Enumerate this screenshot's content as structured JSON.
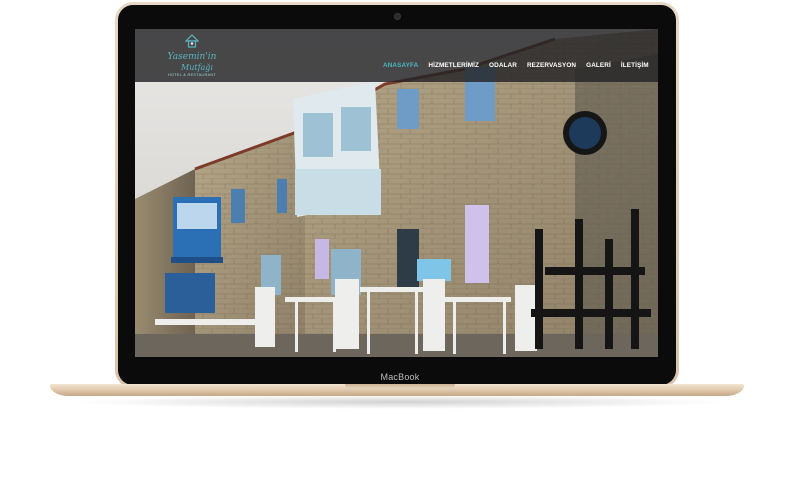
{
  "device": {
    "label": "MacBook"
  },
  "site": {
    "logo": {
      "line1": "Yasemin'in",
      "line2": "Mutfağı",
      "line3": "HOTEL & RESTAURANT"
    },
    "menu": [
      {
        "label": "ANASAYFA",
        "active": true
      },
      {
        "label": "HİZMETLERİMİZ"
      },
      {
        "label": "ODALAR"
      },
      {
        "label": "REZERVASYON"
      },
      {
        "label": "GALERİ"
      },
      {
        "label": "İLETİŞİM"
      }
    ]
  },
  "colors": {
    "accent": "#48b6c6",
    "navbar": "#232326",
    "frame": "#e2ccb1"
  }
}
